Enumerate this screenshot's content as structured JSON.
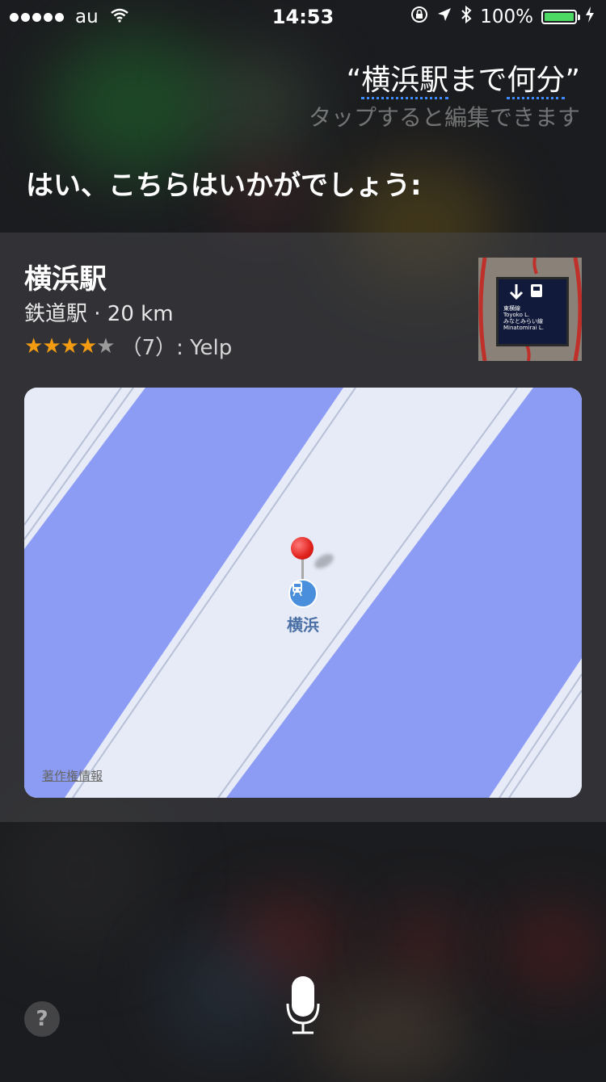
{
  "status": {
    "carrier": "au",
    "time": "14:53",
    "battery": "100%"
  },
  "siri": {
    "query_open": "“",
    "query_part1": "横浜駅",
    "query_part2": "まで",
    "query_part3": "何分",
    "query_close": "”",
    "hint": "タップすると編集できます",
    "reply": "はい、こちらはいかがでしょう:"
  },
  "place": {
    "name": "横浜駅",
    "subtitle": "鉄道駅 · 20 km",
    "rating_value": 4,
    "rating_max": 5,
    "rating_text": "（7）: Yelp"
  },
  "thumb": {
    "sign_line1": "東横線",
    "sign_line2": "Toyoko L.",
    "sign_line3": "みなとみらい線",
    "sign_line4": "Minatomirai L."
  },
  "map": {
    "station_label": "横浜",
    "copyright": "著作権情報"
  },
  "controls": {
    "help": "?"
  },
  "colors": {
    "accent_blue": "#3d8bff",
    "star": "#f39c12",
    "map_water": "#8c9cf5",
    "map_land": "#e6ebf7",
    "pin": "#e0201b"
  },
  "icons": [
    "wifi-icon",
    "lock-rotation-icon",
    "location-arrow-icon",
    "bluetooth-icon",
    "charging-icon",
    "map-pin-icon",
    "train-icon",
    "microphone-icon",
    "help-icon"
  ]
}
